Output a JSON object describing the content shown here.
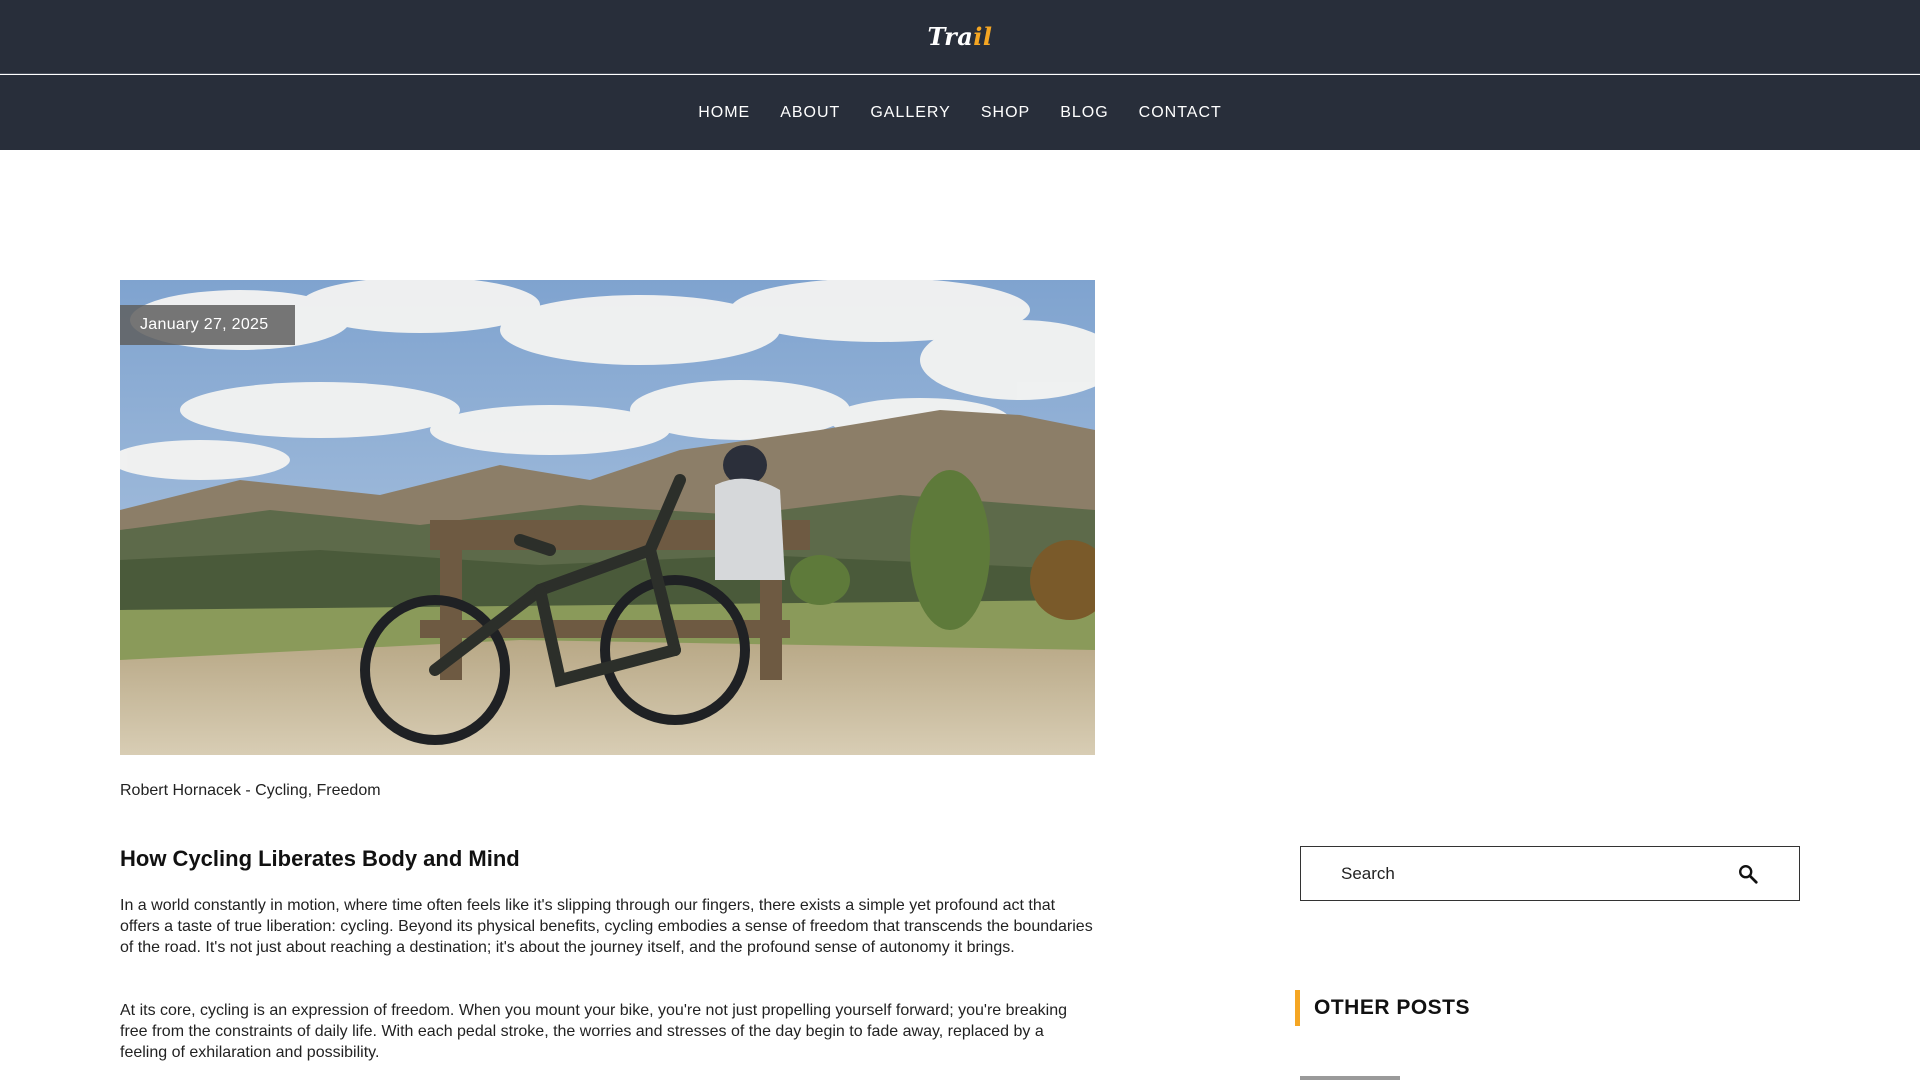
{
  "header": {
    "logo_main": "Tra",
    "logo_accent": "il"
  },
  "nav": {
    "items": [
      "HOME",
      "ABOUT",
      "GALLERY",
      "SHOP",
      "BLOG",
      "CONTACT"
    ]
  },
  "post": {
    "date": "January 27, 2025",
    "meta": "Robert Hornacek - Cycling, Freedom",
    "title": "How Cycling Liberates Body and Mind",
    "paragraphs": [
      "In a world constantly in motion, where time often feels like it's slipping through our fingers, there exists a simple yet profound act that offers a taste of true liberation: cycling. Beyond its physical benefits, cycling embodies a sense of freedom that transcends the boundaries of the road. It's not just about reaching a destination; it's about the journey itself, and the profound sense of autonomy it brings.",
      "At its core, cycling is an expression of freedom. When you mount your bike, you're not just propelling yourself forward; you're breaking free from the constraints of daily life. With each pedal stroke, the worries and stresses of the day begin to fade away, replaced by a feeling of exhilaration and possibility."
    ]
  },
  "sidebar": {
    "search_placeholder": "Search",
    "other_posts_heading": "OTHER POSTS"
  },
  "colors": {
    "header_bg": "#282e3a",
    "accent": "#f5a623"
  },
  "icons": {
    "search": "search-icon"
  }
}
